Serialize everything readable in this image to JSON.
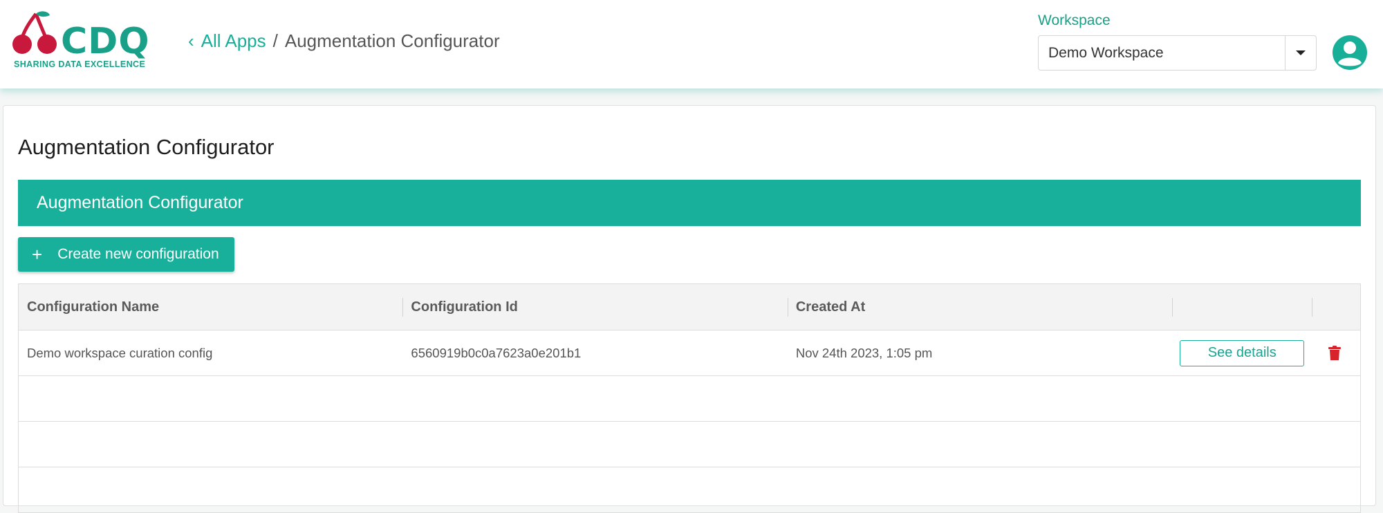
{
  "header": {
    "logo": {
      "word": "CDQ",
      "tagline": "SHARING DATA EXCELLENCE"
    },
    "breadcrumb": {
      "back_label": "All Apps",
      "separator": "/",
      "current": "Augmentation Configurator"
    },
    "workspace": {
      "label": "Workspace",
      "selected": "Demo Workspace"
    },
    "icons": {
      "back": "chevron-left-icon",
      "dropdown": "caret-down-icon",
      "account": "user-avatar-icon"
    }
  },
  "main": {
    "page_title": "Augmentation Configurator",
    "section_title": "Augmentation Configurator",
    "create_button": {
      "icon": "plus-icon",
      "label": "Create new configuration"
    },
    "table": {
      "columns": [
        "Configuration Name",
        "Configuration Id",
        "Created At",
        "",
        ""
      ],
      "rows": [
        {
          "name": "Demo workspace curation config",
          "id": "6560919b0c0a7623a0e201b1",
          "created_at": "Nov 24th 2023, 1:05 pm",
          "details_label": "See details",
          "delete_icon": "trash-icon"
        }
      ]
    }
  },
  "colors": {
    "brand_teal": "#18b09b",
    "brand_red": "#c8193c",
    "delete_red": "#d8232a",
    "header_text": "#555555"
  }
}
